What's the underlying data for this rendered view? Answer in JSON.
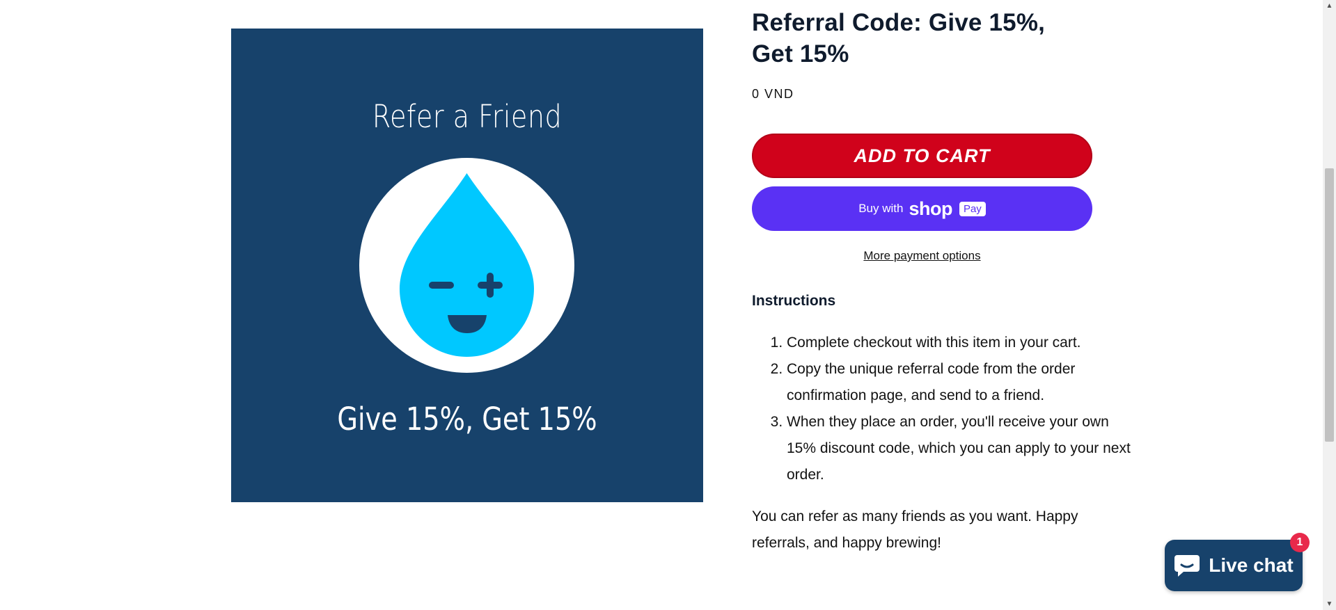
{
  "product": {
    "image": {
      "heading": "Refer a Friend",
      "tagline": "Give 15%, Get 15%",
      "icon": "water-drop-face-icon"
    },
    "title": "Referral Code: Give 15%, Get 15%",
    "price": "0 VND",
    "add_to_cart_label": "ADD TO CART",
    "shop_pay": {
      "prefix": "Buy with",
      "brand": "shop",
      "badge": "Pay"
    },
    "more_payment_options": "More payment options"
  },
  "instructions": {
    "heading": "Instructions",
    "steps": [
      "Complete checkout with this item in your cart.",
      "Copy the unique referral code from the order confirmation page, and send to a friend.",
      "When they place an order, you'll receive your own 15% discount code, which you can apply to your next order."
    ],
    "closing": "You can refer as many friends as you want. Happy referrals, and happy brewing!"
  },
  "live_chat": {
    "label": "Live chat",
    "badge_count": "1",
    "icon": "chat-bubble-icon"
  },
  "colors": {
    "image_bg": "#17426b",
    "drop": "#00c8ff",
    "cart_button": "#d0021b",
    "shop_pay": "#5a31f4",
    "chat_badge": "#e8294b"
  }
}
